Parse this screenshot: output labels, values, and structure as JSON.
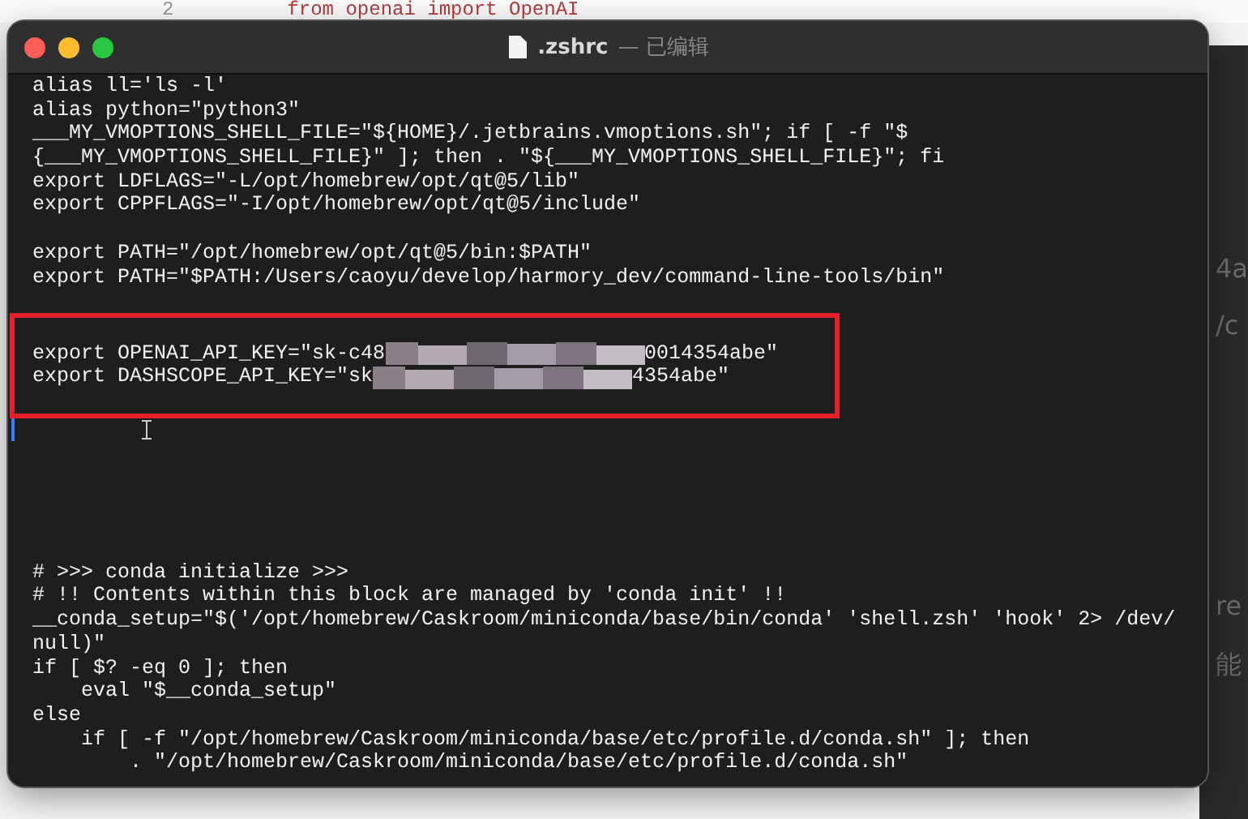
{
  "background_editor": {
    "line_number": "2",
    "code": "from openai import OpenAI",
    "side_fragments": [
      "4a",
      "/c",
      "re",
      "能"
    ]
  },
  "window": {
    "title": ".zshrc",
    "status": "— 已编辑"
  },
  "editor": {
    "blocks": [
      {
        "highlighted": false,
        "lines": [
          {
            "kind": "text",
            "text": "alias ll='ls -l'"
          },
          {
            "kind": "text",
            "text": "alias python=\"python3\""
          },
          {
            "kind": "text",
            "text": "___MY_VMOPTIONS_SHELL_FILE=\"${HOME}/.jetbrains.vmoptions.sh\"; if [ -f \"$"
          },
          {
            "kind": "text",
            "text": "{___MY_VMOPTIONS_SHELL_FILE}\" ]; then . \"${___MY_VMOPTIONS_SHELL_FILE}\"; fi"
          },
          {
            "kind": "text",
            "text": "export LDFLAGS=\"-L/opt/homebrew/opt/qt@5/lib\""
          },
          {
            "kind": "text",
            "text": "export CPPFLAGS=\"-I/opt/homebrew/opt/qt@5/include\""
          },
          {
            "kind": "blank"
          },
          {
            "kind": "text",
            "text": "export PATH=\"/opt/homebrew/opt/qt@5/bin:$PATH\""
          },
          {
            "kind": "text",
            "text": "export PATH=\"$PATH:/Users/caoyu/develop/harmory_dev/command-line-tools/bin\""
          },
          {
            "kind": "blank"
          }
        ]
      },
      {
        "highlighted": true,
        "lines": [
          {
            "kind": "blank"
          },
          {
            "kind": "redacted",
            "prefix": "export OPENAI_API_KEY=\"sk-c48",
            "suffix": "0014354abe\""
          },
          {
            "kind": "redacted",
            "prefix": "export DASHSCOPE_API_KEY=\"sk",
            "suffix": "4354abe\""
          },
          {
            "kind": "blank"
          }
        ]
      },
      {
        "highlighted": false,
        "lines": [
          {
            "kind": "cursor"
          },
          {
            "kind": "blank"
          },
          {
            "kind": "blank"
          },
          {
            "kind": "blank"
          },
          {
            "kind": "blank"
          },
          {
            "kind": "blank"
          },
          {
            "kind": "text",
            "text": "# >>> conda initialize >>>"
          },
          {
            "kind": "text",
            "text": "# !! Contents within this block are managed by 'conda init' !!"
          },
          {
            "kind": "text",
            "text": "__conda_setup=\"$('/opt/homebrew/Caskroom/miniconda/base/bin/conda' 'shell.zsh' 'hook' 2> /dev/"
          },
          {
            "kind": "text",
            "text": "null)\""
          },
          {
            "kind": "text",
            "text": "if [ $? -eq 0 ]; then"
          },
          {
            "kind": "text",
            "text": "    eval \"$__conda_setup\""
          },
          {
            "kind": "text",
            "text": "else"
          },
          {
            "kind": "text",
            "text": "    if [ -f \"/opt/homebrew/Caskroom/miniconda/base/etc/profile.d/conda.sh\" ]; then"
          },
          {
            "kind": "text",
            "text": "        . \"/opt/homebrew/Caskroom/miniconda/base/etc/profile.d/conda.sh\""
          }
        ]
      }
    ]
  }
}
